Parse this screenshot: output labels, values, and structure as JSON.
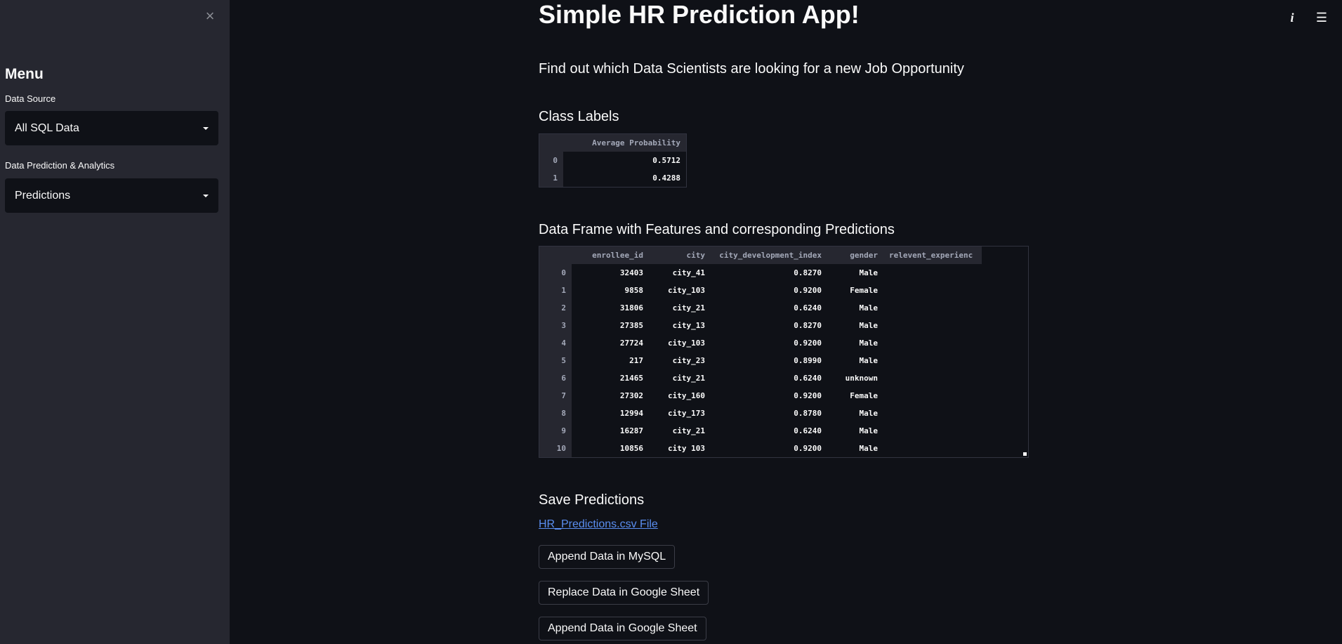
{
  "sidebar": {
    "close_icon": "×",
    "menu_title": "Menu",
    "data_source_label": "Data Source",
    "data_source_value": "All SQL Data",
    "prediction_label": "Data Prediction & Analytics",
    "prediction_value": "Predictions"
  },
  "top_icons": {
    "info": "i",
    "menu": "☰"
  },
  "main": {
    "title": "Simple HR Prediction App!",
    "subtitle": "Find out which Data Scientists are looking for a new Job Opportunity",
    "class_labels_heading": "Class Labels",
    "class_table": {
      "columns": [
        "",
        "Average Probability"
      ],
      "rows": [
        {
          "idx": "0",
          "prob": "0.5712"
        },
        {
          "idx": "1",
          "prob": "0.4288"
        }
      ]
    },
    "df_heading": "Data Frame with Features and corresponding Predictions",
    "df_table": {
      "columns": [
        "",
        "enrollee_id",
        "city",
        "city_development_index",
        "gender",
        "relevent_experienc"
      ],
      "rows": [
        [
          "0",
          "32403",
          "city_41",
          "0.8270",
          "Male",
          ""
        ],
        [
          "1",
          "9858",
          "city_103",
          "0.9200",
          "Female",
          ""
        ],
        [
          "2",
          "31806",
          "city_21",
          "0.6240",
          "Male",
          ""
        ],
        [
          "3",
          "27385",
          "city_13",
          "0.8270",
          "Male",
          ""
        ],
        [
          "4",
          "27724",
          "city_103",
          "0.9200",
          "Male",
          ""
        ],
        [
          "5",
          "217",
          "city_23",
          "0.8990",
          "Male",
          ""
        ],
        [
          "6",
          "21465",
          "city_21",
          "0.6240",
          "unknown",
          ""
        ],
        [
          "7",
          "27302",
          "city_160",
          "0.9200",
          "Female",
          ""
        ],
        [
          "8",
          "12994",
          "city_173",
          "0.8780",
          "Male",
          ""
        ],
        [
          "9",
          "16287",
          "city_21",
          "0.6240",
          "Male",
          ""
        ],
        [
          "10",
          "10856",
          "city 103",
          "0.9200",
          "Male",
          ""
        ]
      ]
    },
    "save_heading": "Save Predictions",
    "csv_link": "HR_Predictions.csv File",
    "buttons": {
      "append_mysql": "Append Data in MySQL",
      "replace_gsheet": "Replace Data in Google Sheet",
      "append_gsheet": "Append Data in Google Sheet"
    }
  },
  "colors": {
    "background": "#0f1117",
    "sidebar": "#262730",
    "link": "#5a8ef0"
  }
}
